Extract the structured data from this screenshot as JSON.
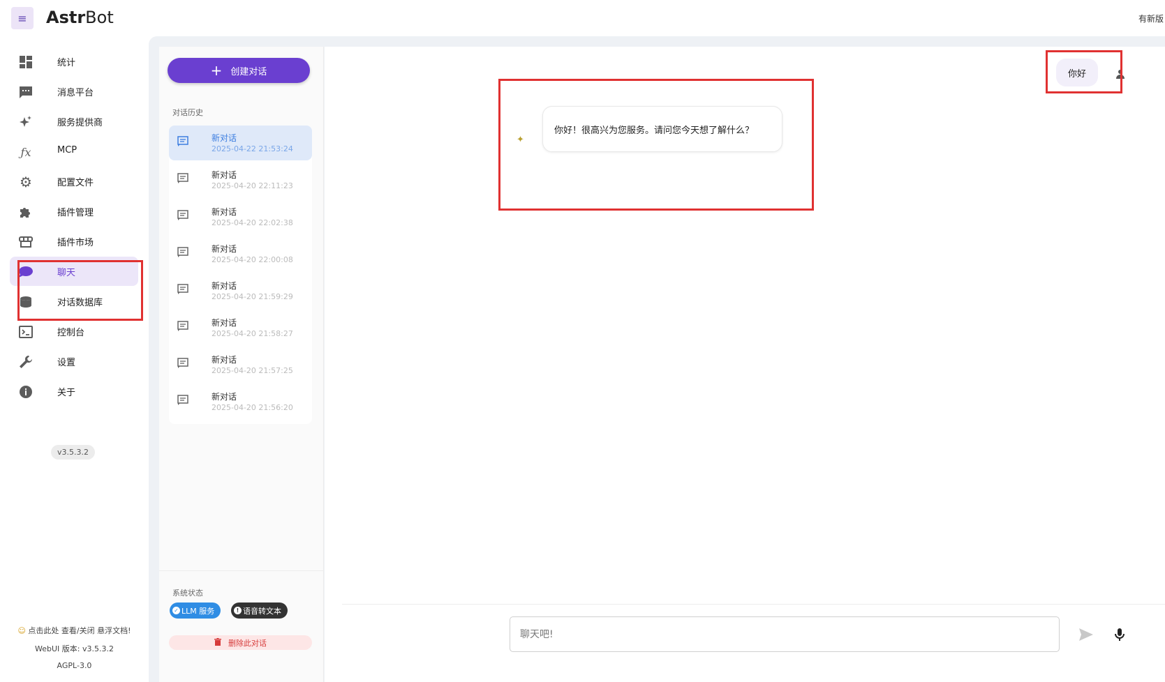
{
  "app": {
    "brand_bold": "Astr",
    "brand_rest": "Bot",
    "update_notice": "有新版"
  },
  "sidebar": {
    "items": [
      {
        "label": "统计",
        "icon": "dashboard-icon"
      },
      {
        "label": "消息平台",
        "icon": "message-icon"
      },
      {
        "label": "服务提供商",
        "icon": "sparkle-icon"
      },
      {
        "label": "MCP",
        "icon": "function-icon"
      },
      {
        "label": "配置文件",
        "icon": "gear-icon"
      },
      {
        "label": "插件管理",
        "icon": "puzzle-icon"
      },
      {
        "label": "插件市场",
        "icon": "store-icon"
      },
      {
        "label": "聊天",
        "icon": "chat-icon",
        "active": true
      },
      {
        "label": "对话数据库",
        "icon": "database-icon"
      },
      {
        "label": "控制台",
        "icon": "console-icon"
      },
      {
        "label": "设置",
        "icon": "wrench-icon"
      },
      {
        "label": "关于",
        "icon": "info-icon"
      }
    ],
    "version": "v3.5.3.2",
    "float_doc_hint": "点击此处 查看/关闭 悬浮文档!",
    "webui_version": "WebUI 版本: v3.5.3.2",
    "license": "AGPL-3.0"
  },
  "conversations": {
    "create_label": "创建对话",
    "history_label": "对话历史",
    "items": [
      {
        "title": "新对话",
        "date": "2025-04-22 21:53:24",
        "active": true
      },
      {
        "title": "新对话",
        "date": "2025-04-20 22:11:23"
      },
      {
        "title": "新对话",
        "date": "2025-04-20 22:02:38"
      },
      {
        "title": "新对话",
        "date": "2025-04-20 22:00:08"
      },
      {
        "title": "新对话",
        "date": "2025-04-20 21:59:29"
      },
      {
        "title": "新对话",
        "date": "2025-04-20 21:58:27"
      },
      {
        "title": "新对话",
        "date": "2025-04-20 21:57:25"
      },
      {
        "title": "新对话",
        "date": "2025-04-20 21:56:20"
      }
    ],
    "status_label": "系统状态",
    "status_chips": [
      {
        "label": "LLM 服务",
        "style": "blue",
        "mark": "✓"
      },
      {
        "label": "语音转文本",
        "style": "dark",
        "mark": "!"
      }
    ],
    "delete_label": "删除此对话"
  },
  "chat": {
    "messages": [
      {
        "role": "user",
        "text": "你好"
      },
      {
        "role": "bot",
        "text": "你好！很高兴为您服务。请问您今天想了解什么？"
      }
    ],
    "input_placeholder": "聊天吧!"
  },
  "colors": {
    "accent": "#6a3fd0",
    "highlight_box": "#e03131",
    "chip_blue": "#2f8de4",
    "active_conv": "#dfe9f9"
  }
}
